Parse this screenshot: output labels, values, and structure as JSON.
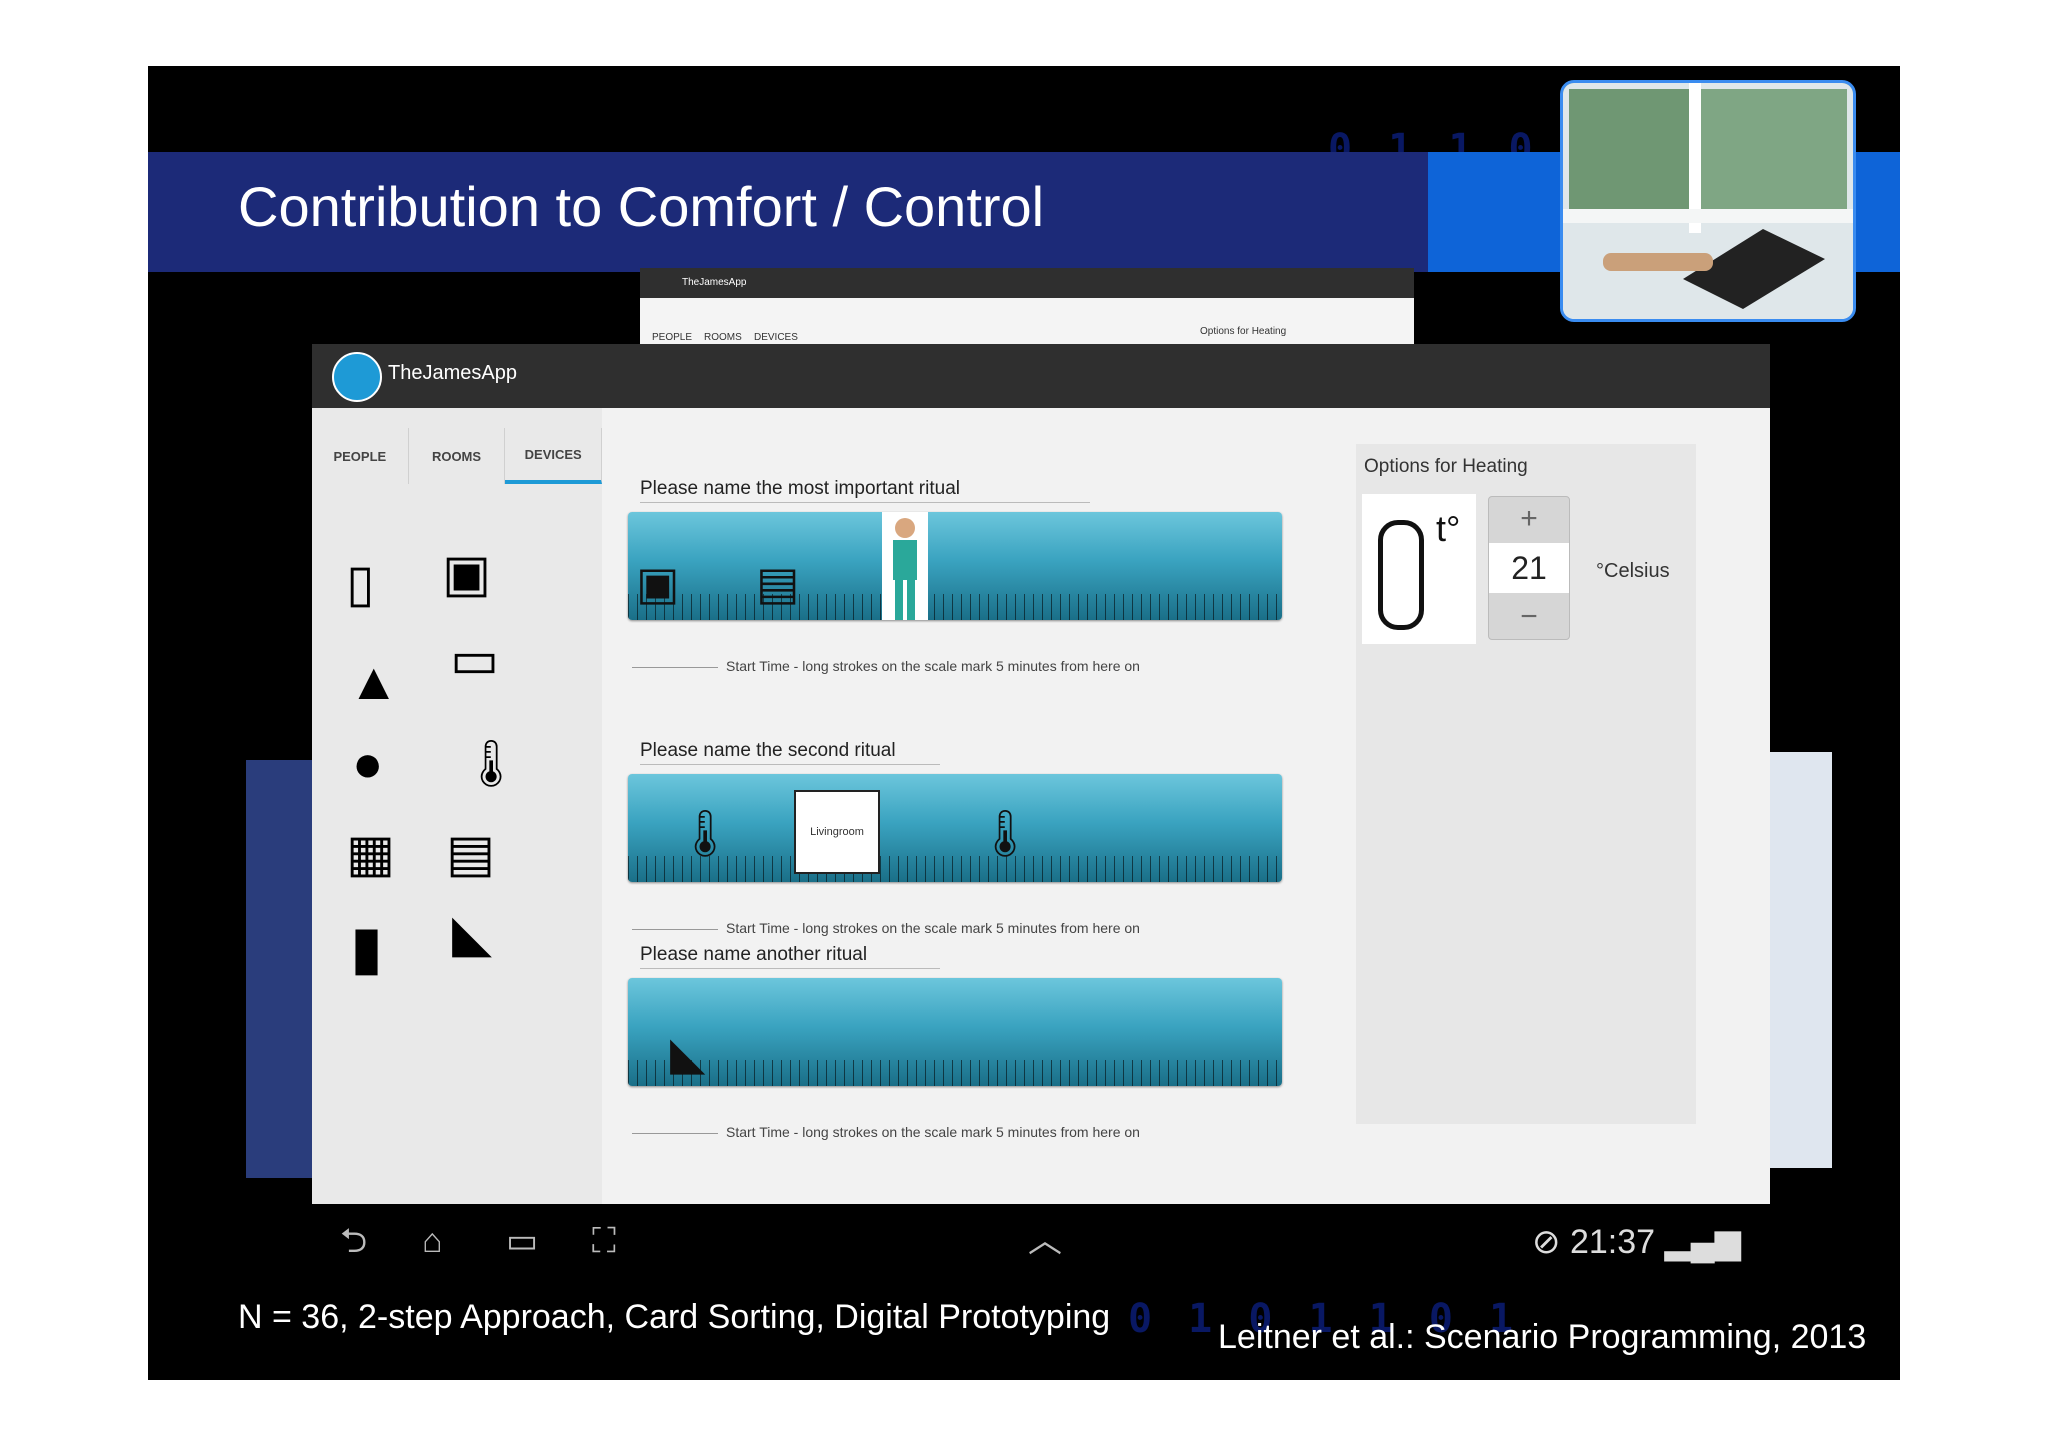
{
  "slide": {
    "title": "Contribution to Comfort / Control",
    "footer_left": "N = 36, 2-step Approach, Card Sorting, Digital Prototyping",
    "footer_right": "Leitner et al.: Scenario Programming,  2013"
  },
  "app": {
    "name": "TheJamesApp",
    "tabs": [
      "PEOPLE",
      "ROOMS",
      "DEVICES"
    ],
    "active_tab": "DEVICES",
    "devices": [
      "light-switch",
      "microwave",
      "monitor",
      "alarm-siren",
      "light-bulb",
      "thermometer",
      "coffee-machine",
      "printer",
      "door",
      "iron"
    ],
    "rituals": [
      {
        "label": "Please name the most important ritual",
        "start_hint": "Start Time - long strokes on the scale mark 5 minutes from here on",
        "items": [
          "microwave",
          "printer",
          "person"
        ]
      },
      {
        "label": "Please name the second ritual",
        "start_hint": "Start Time - long strokes on the scale mark 5 minutes from here on",
        "items": [
          "thermometer",
          "Livingroom",
          "thermometer"
        ]
      },
      {
        "label": "Please name another ritual",
        "start_hint": "Start Time - long strokes on the scale mark 5 minutes from here on",
        "items": [
          "iron"
        ]
      }
    ],
    "options": {
      "title": "Options for Heating",
      "t_label": "t°",
      "plus": "+",
      "minus": "−",
      "value": "21",
      "unit": "°Celsius"
    }
  },
  "background_window": {
    "app_name": "TheJamesApp",
    "tabs": [
      "PEOPLE",
      "ROOMS",
      "DEVICES"
    ],
    "options_title": "Options for Heating"
  },
  "statusbar": {
    "time": "21:37"
  },
  "colors": {
    "title_band": "#1c2a78",
    "accent_blue": "#0e64d8",
    "track_top": "#6cc6dc",
    "track_bottom": "#1a6f88",
    "tab_indicator": "#1e9ad6"
  }
}
